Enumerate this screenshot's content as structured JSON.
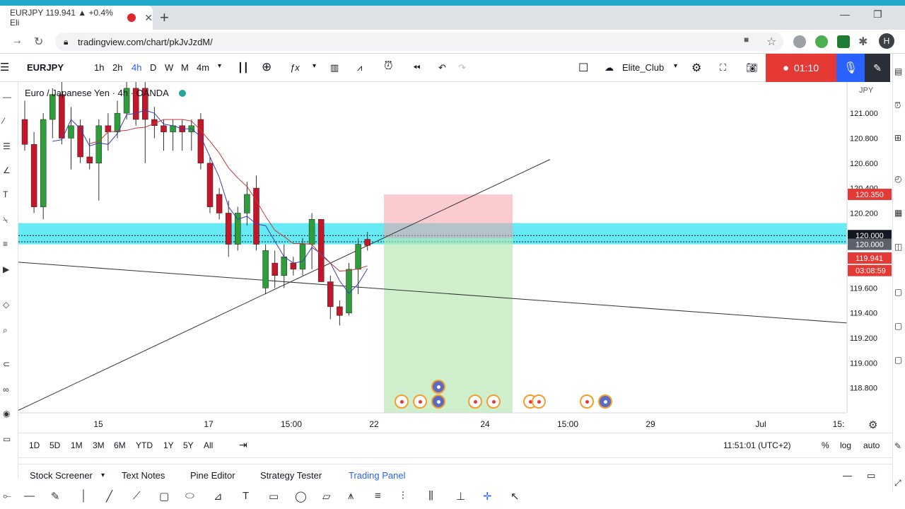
{
  "browser": {
    "tab_title": "EURJPY 119.941 ▲ +0.4% Eli",
    "url": "tradingview.com/chart/pkJvJzdM/",
    "profile_initial": "H"
  },
  "toolbar": {
    "symbol": "EURJPY",
    "timeframes": [
      "1h",
      "2h",
      "4h",
      "D",
      "W",
      "M",
      "4m"
    ],
    "active_timeframe": "4h",
    "layout_name": "Elite_Club",
    "rec_time": "01:10"
  },
  "legend": {
    "text": "Euro / Japanese Yen · 4h · OANDA"
  },
  "price_axis": {
    "currency": "JPY",
    "labels": [
      "121.000",
      "120.800",
      "120.600",
      "120.400",
      "120.200",
      "120.000",
      "119.600",
      "119.400",
      "119.200",
      "119.000",
      "118.800"
    ],
    "tags": [
      {
        "text": "120.350",
        "color": "#e53935"
      },
      {
        "text": "120.000",
        "color": "#131722"
      },
      {
        "text": "120.000",
        "color": "#5d606b"
      },
      {
        "text": "119.941",
        "color": "#e53935"
      },
      {
        "text": "03:08:59",
        "color": "#e53935"
      }
    ]
  },
  "time_axis": {
    "labels": [
      "15",
      "17",
      "15:00",
      "22",
      "24",
      "15:00",
      "29",
      "Jul",
      "15:"
    ]
  },
  "range_bar": {
    "ranges": [
      "1D",
      "5D",
      "1M",
      "3M",
      "6M",
      "YTD",
      "1Y",
      "5Y",
      "All"
    ],
    "clock": "11:51:01 (UTC+2)",
    "options": [
      "%",
      "log",
      "auto"
    ]
  },
  "bottom_tabs": {
    "items": [
      "Stock Screener",
      "Text Notes",
      "Pine Editor",
      "Strategy Tester",
      "Trading Panel"
    ],
    "active": "Trading Panel"
  },
  "chart_data": {
    "type": "candlestick",
    "title": "Euro / Japanese Yen · 4h · OANDA",
    "ylim": [
      118.6,
      121.25
    ],
    "x_ticks": [
      "15",
      "17",
      "15:00",
      "22",
      "24",
      "15:00",
      "29",
      "Jul",
      "15:"
    ],
    "candles": [
      {
        "o": 120.95,
        "h": 121.1,
        "l": 120.7,
        "c": 120.75
      },
      {
        "o": 120.75,
        "h": 120.85,
        "l": 120.2,
        "c": 120.25
      },
      {
        "o": 120.25,
        "h": 121.0,
        "l": 120.15,
        "c": 120.95
      },
      {
        "o": 120.95,
        "h": 121.2,
        "l": 120.8,
        "c": 121.15
      },
      {
        "o": 121.15,
        "h": 121.25,
        "l": 120.75,
        "c": 120.8
      },
      {
        "o": 120.8,
        "h": 121.05,
        "l": 120.55,
        "c": 120.9
      },
      {
        "o": 120.9,
        "h": 120.95,
        "l": 120.6,
        "c": 120.65
      },
      {
        "o": 120.65,
        "h": 120.8,
        "l": 120.55,
        "c": 120.6
      },
      {
        "o": 120.6,
        "h": 120.95,
        "l": 120.3,
        "c": 120.9
      },
      {
        "o": 120.9,
        "h": 121.0,
        "l": 120.7,
        "c": 120.85
      },
      {
        "o": 120.85,
        "h": 121.1,
        "l": 120.8,
        "c": 121.0
      },
      {
        "o": 121.0,
        "h": 121.25,
        "l": 120.95,
        "c": 121.2
      },
      {
        "o": 121.2,
        "h": 121.25,
        "l": 120.9,
        "c": 120.95
      },
      {
        "o": 121.2,
        "h": 121.25,
        "l": 120.6,
        "c": 120.95
      },
      {
        "o": 120.95,
        "h": 121.05,
        "l": 120.8,
        "c": 120.9
      },
      {
        "o": 120.9,
        "h": 120.95,
        "l": 120.7,
        "c": 120.85
      },
      {
        "o": 120.85,
        "h": 120.95,
        "l": 120.7,
        "c": 120.9
      },
      {
        "o": 120.9,
        "h": 120.95,
        "l": 120.7,
        "c": 120.85
      },
      {
        "o": 120.85,
        "h": 120.95,
        "l": 120.7,
        "c": 120.9
      },
      {
        "o": 120.95,
        "h": 121.0,
        "l": 120.55,
        "c": 120.6
      },
      {
        "o": 120.6,
        "h": 120.65,
        "l": 120.2,
        "c": 120.25
      },
      {
        "o": 120.35,
        "h": 120.4,
        "l": 120.15,
        "c": 120.2
      },
      {
        "o": 120.2,
        "h": 120.3,
        "l": 119.85,
        "c": 119.95
      },
      {
        "o": 119.95,
        "h": 120.25,
        "l": 119.9,
        "c": 120.2
      },
      {
        "o": 120.2,
        "h": 120.45,
        "l": 120.1,
        "c": 120.35
      },
      {
        "o": 120.4,
        "h": 120.5,
        "l": 119.9,
        "c": 119.95
      },
      {
        "o": 119.6,
        "h": 119.95,
        "l": 119.55,
        "c": 119.9
      },
      {
        "o": 119.8,
        "h": 119.9,
        "l": 119.6,
        "c": 119.7
      },
      {
        "o": 119.7,
        "h": 119.95,
        "l": 119.6,
        "c": 119.85
      },
      {
        "o": 119.8,
        "h": 119.85,
        "l": 119.7,
        "c": 119.75
      },
      {
        "o": 119.75,
        "h": 120.0,
        "l": 119.7,
        "c": 119.95
      },
      {
        "o": 119.95,
        "h": 120.2,
        "l": 119.75,
        "c": 120.15
      },
      {
        "o": 120.15,
        "h": 120.15,
        "l": 119.65,
        "c": 119.65
      },
      {
        "o": 119.65,
        "h": 119.7,
        "l": 119.35,
        "c": 119.45
      },
      {
        "o": 119.45,
        "h": 119.5,
        "l": 119.3,
        "c": 119.38
      },
      {
        "o": 119.4,
        "h": 119.8,
        "l": 119.38,
        "c": 119.75
      },
      {
        "o": 119.75,
        "h": 120.0,
        "l": 119.55,
        "c": 119.95
      },
      {
        "o": 119.99,
        "h": 120.05,
        "l": 119.9,
        "c": 119.94
      }
    ],
    "annotations": {
      "short_position": {
        "entry": 120.0,
        "stop": 120.35,
        "target": 118.6
      },
      "horizontal_zone": [
        119.95,
        120.12
      ]
    }
  }
}
